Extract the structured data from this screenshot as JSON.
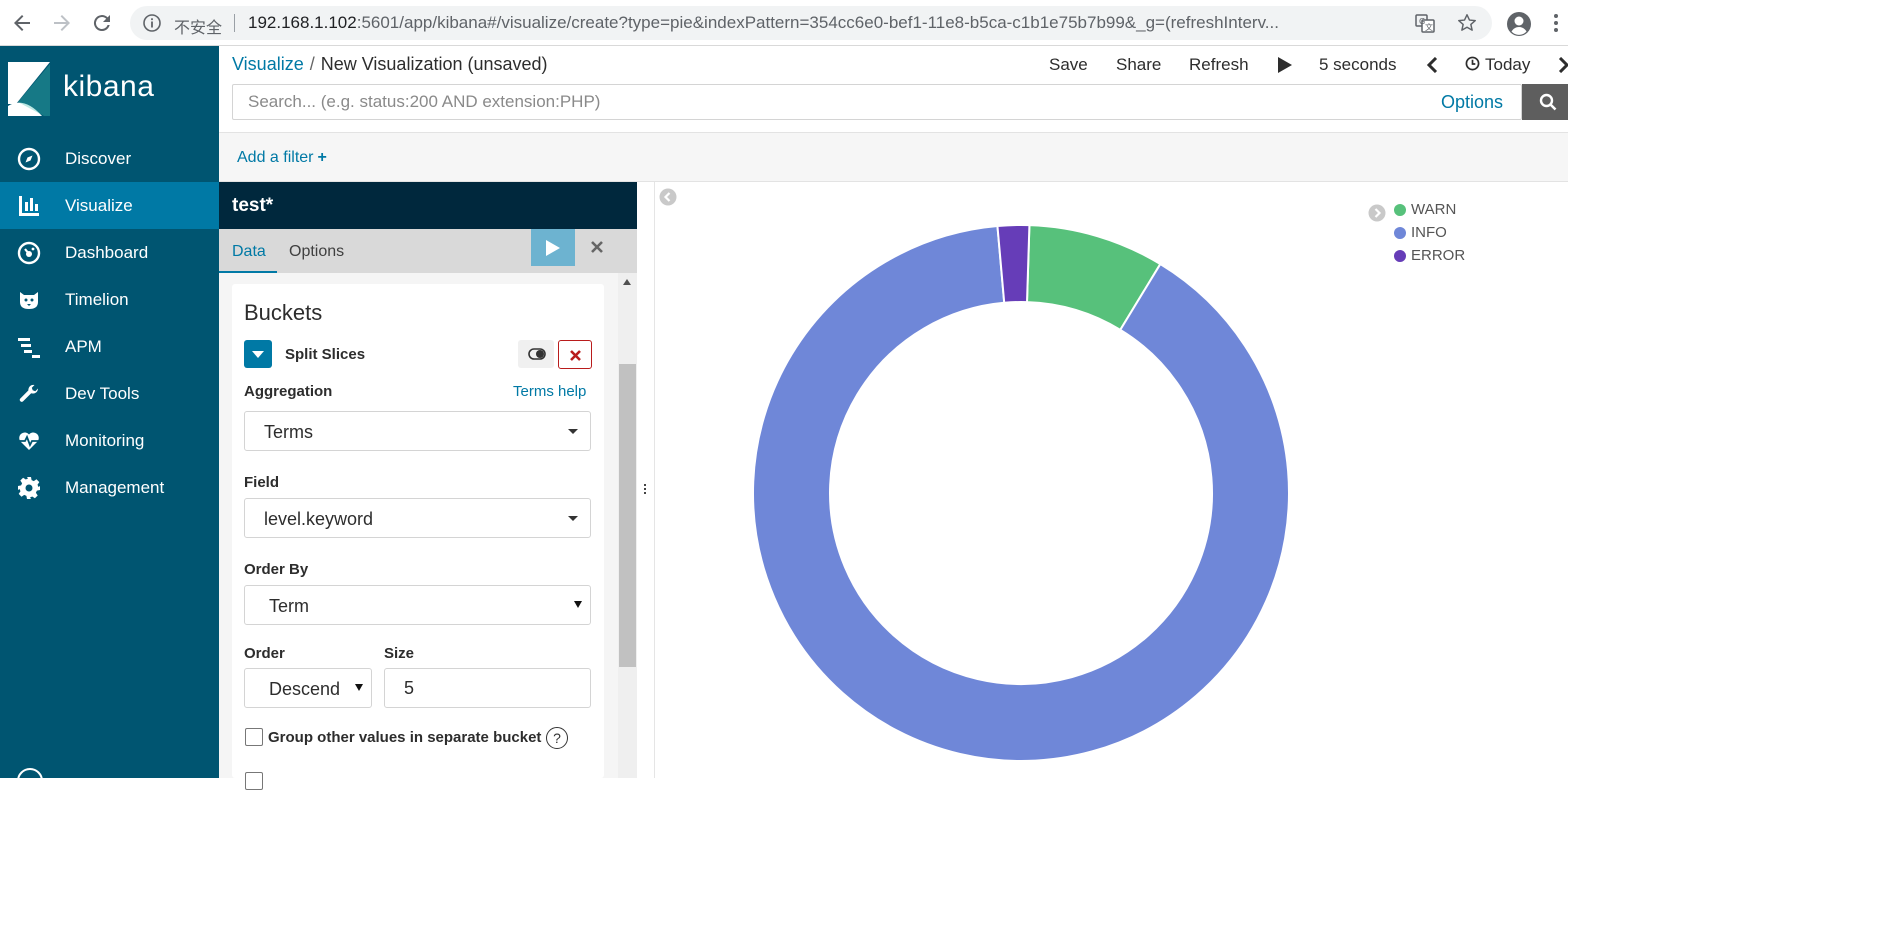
{
  "browser": {
    "insecure_label": "不安全",
    "url_host": "192.168.1.102",
    "url_rest": ":5601/app/kibana#/visualize/create?type=pie&indexPattern=354cc6e0-bef1-11e8-b5ca-c1b1e75b7b99&_g=(refreshInterv..."
  },
  "nav": {
    "logo_text": "kibana",
    "items": [
      {
        "label": "Discover",
        "icon": "compass-icon"
      },
      {
        "label": "Visualize",
        "icon": "bar-chart-icon",
        "active": true
      },
      {
        "label": "Dashboard",
        "icon": "dashboard-icon"
      },
      {
        "label": "Timelion",
        "icon": "timelion-icon"
      },
      {
        "label": "APM",
        "icon": "apm-icon"
      },
      {
        "label": "Dev Tools",
        "icon": "wrench-icon"
      },
      {
        "label": "Monitoring",
        "icon": "heartbeat-icon"
      },
      {
        "label": "Management",
        "icon": "gear-icon"
      }
    ]
  },
  "topbar": {
    "breadcrumb_link": "Visualize",
    "breadcrumb_separator": "/",
    "breadcrumb_current": "New Visualization (unsaved)",
    "save": "Save",
    "share": "Share",
    "refresh": "Refresh",
    "interval": "5 seconds",
    "time": "Today",
    "search_placeholder": "Search... (e.g. status:200 AND extension:PHP)",
    "options": "Options"
  },
  "filterbar": {
    "add_filter": "Add a filter"
  },
  "editor": {
    "index_title": "test*",
    "tabs": [
      "Data",
      "Options"
    ],
    "buckets_heading": "Buckets",
    "agg_name": "Split Slices",
    "aggregation_label": "Aggregation",
    "aggregation_help": "Terms help",
    "aggregation_value": "Terms",
    "field_label": "Field",
    "field_value": "level.keyword",
    "orderby_label": "Order By",
    "orderby_value": "Term",
    "order_label": "Order",
    "order_value": "Descending",
    "size_label": "Size",
    "size_value": "5",
    "group_other_label": "Group other values in separate bucket",
    "help_symbol": "?"
  },
  "colors": {
    "sidenav": "#005571",
    "sidenav_active": "#0079a5",
    "link": "#0079a5"
  },
  "chart_data": {
    "type": "pie",
    "donut": true,
    "categories": [
      "WARN",
      "INFO",
      "ERROR"
    ],
    "values": [
      8.2,
      89.9,
      1.9
    ],
    "colors": [
      "#57c17b",
      "#6f87d8",
      "#663db8"
    ],
    "legend": "top-right"
  }
}
